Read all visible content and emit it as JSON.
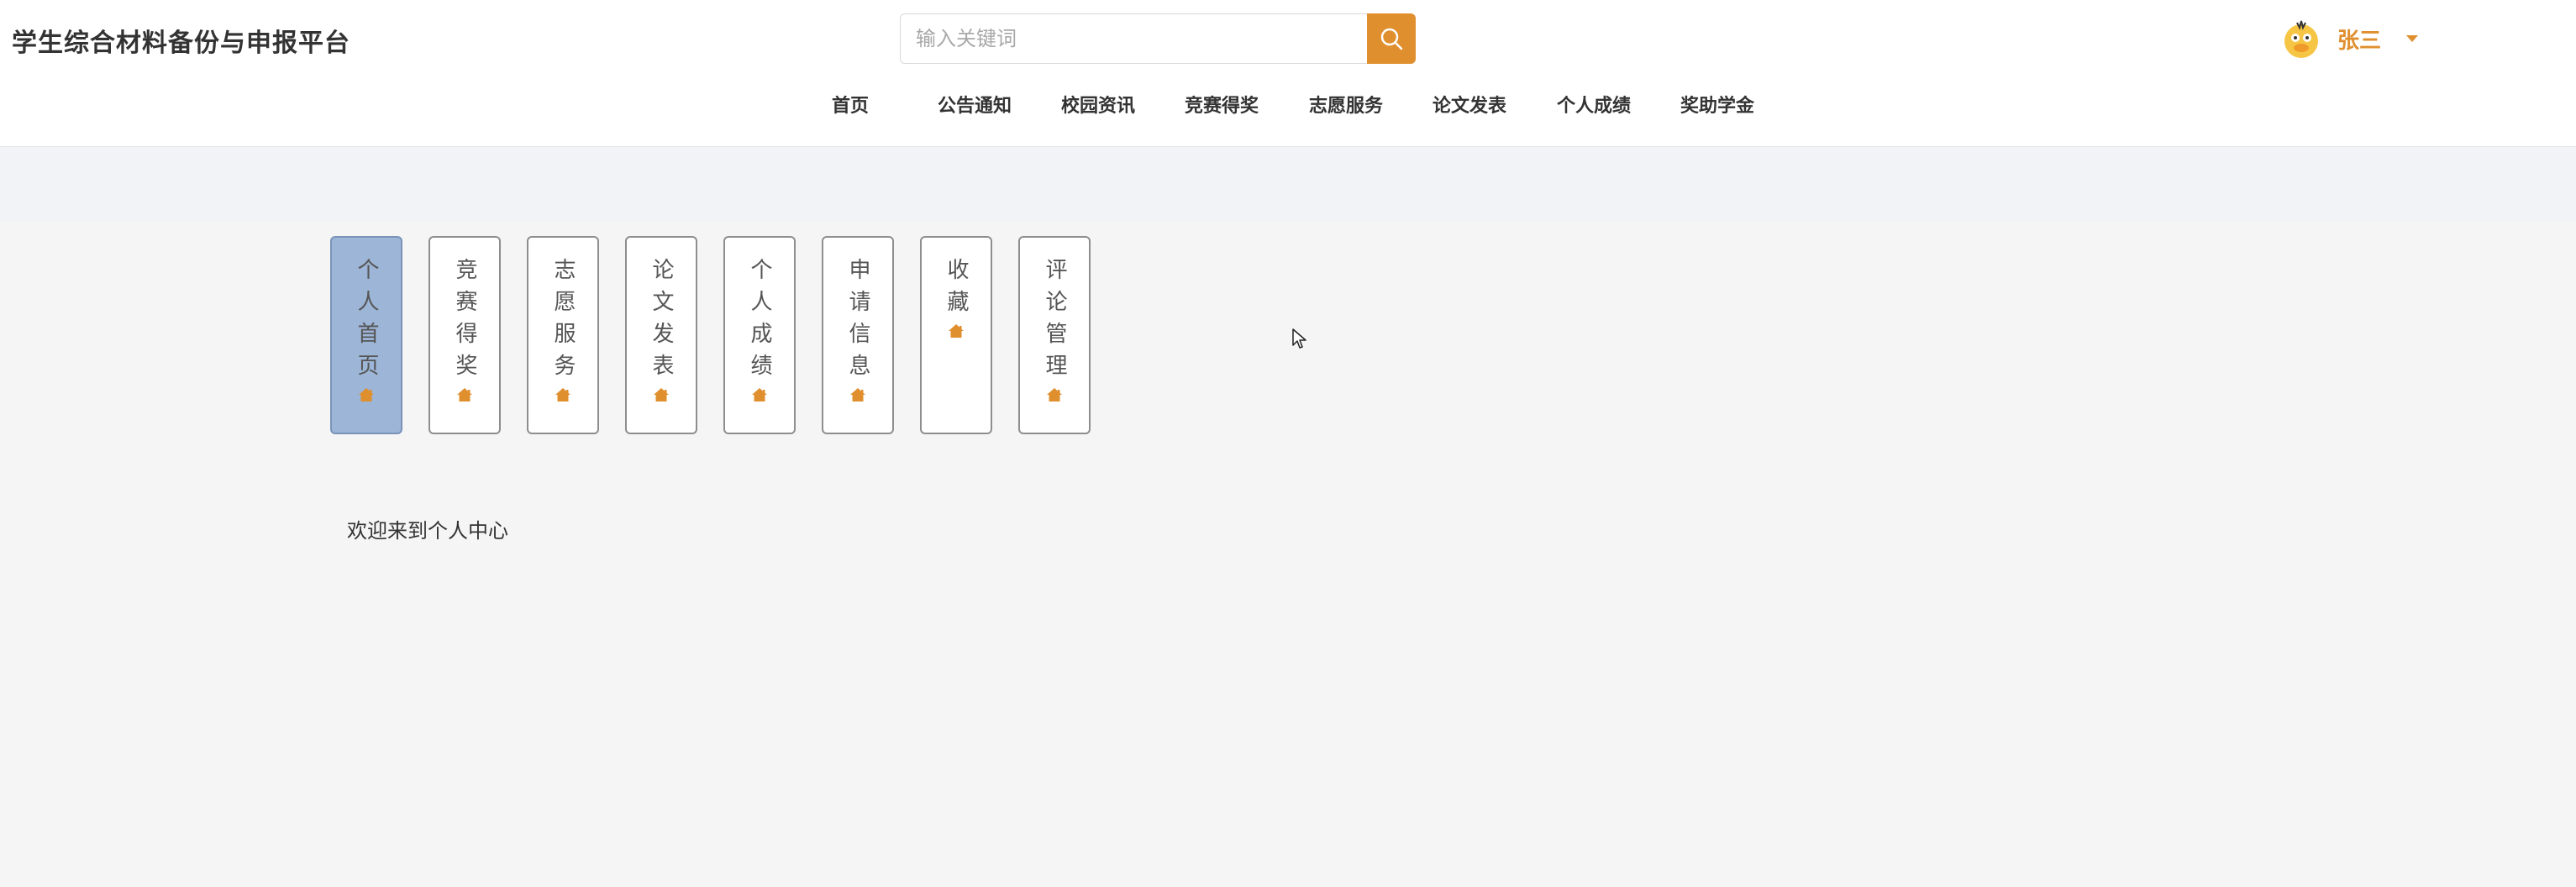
{
  "header": {
    "site_title": "学生综合材料备份与申报平台",
    "search": {
      "placeholder": "输入关键词",
      "value": ""
    },
    "user": {
      "name": "张三",
      "avatar_icon": "duck-avatar-icon"
    }
  },
  "nav": {
    "items": [
      {
        "label": "首页"
      },
      {
        "label": "公告通知"
      },
      {
        "label": "校园资讯"
      },
      {
        "label": "竞赛得奖"
      },
      {
        "label": "志愿服务"
      },
      {
        "label": "论文发表"
      },
      {
        "label": "个人成绩"
      },
      {
        "label": "奖助学金"
      }
    ]
  },
  "side_tabs": {
    "items": [
      {
        "label": "个人首页",
        "icon": "home-icon",
        "active": true
      },
      {
        "label": "竞赛得奖",
        "icon": "home-icon",
        "active": false
      },
      {
        "label": "志愿服务",
        "icon": "home-icon",
        "active": false
      },
      {
        "label": "论文发表",
        "icon": "home-icon",
        "active": false
      },
      {
        "label": "个人成绩",
        "icon": "home-icon",
        "active": false
      },
      {
        "label": "申请信息",
        "icon": "home-icon",
        "active": false
      },
      {
        "label": "收藏",
        "icon": "home-icon",
        "active": false
      },
      {
        "label": "评论管理",
        "icon": "home-icon",
        "active": false
      }
    ]
  },
  "main": {
    "welcome_text": "欢迎来到个人中心"
  },
  "colors": {
    "accent": "#e08f2e",
    "active_tab": "#9db5d6",
    "band": "#f1f3f6",
    "page_bg": "#f5f5f5"
  }
}
